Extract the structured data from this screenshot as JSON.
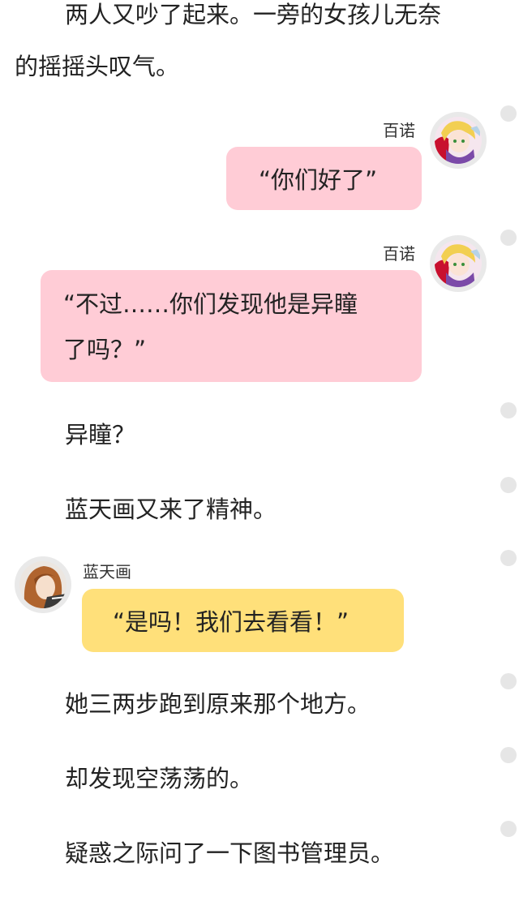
{
  "narration": {
    "p1_line1": "两人又吵了起来。一旁的女孩儿无奈",
    "p1_line2": "的摇摇头叹气。",
    "p2": "异瞳？",
    "p3": "蓝天画又来了精神。",
    "p4": "她三两步跑到原来那个地方。",
    "p5": "却发现空荡荡的。",
    "p6": "疑惑之际问了一下图书管理员。"
  },
  "messages": [
    {
      "speaker": "百诺",
      "text": "“你们好了”",
      "color": "#ffccd6"
    },
    {
      "speaker": "百诺",
      "line1": "“不过……你们发现他是异瞳",
      "line2": "了吗？”",
      "color": "#ffccd6"
    },
    {
      "speaker": "蓝天画",
      "text": "“是吗！我们去看看！”",
      "color": "#ffe07a"
    }
  ],
  "icons": {
    "avatar_right": "blonde-girl-avatar-icon",
    "avatar_left": "brown-hair-avatar-icon",
    "side_dots": "scroll-marker-dot-icon"
  }
}
